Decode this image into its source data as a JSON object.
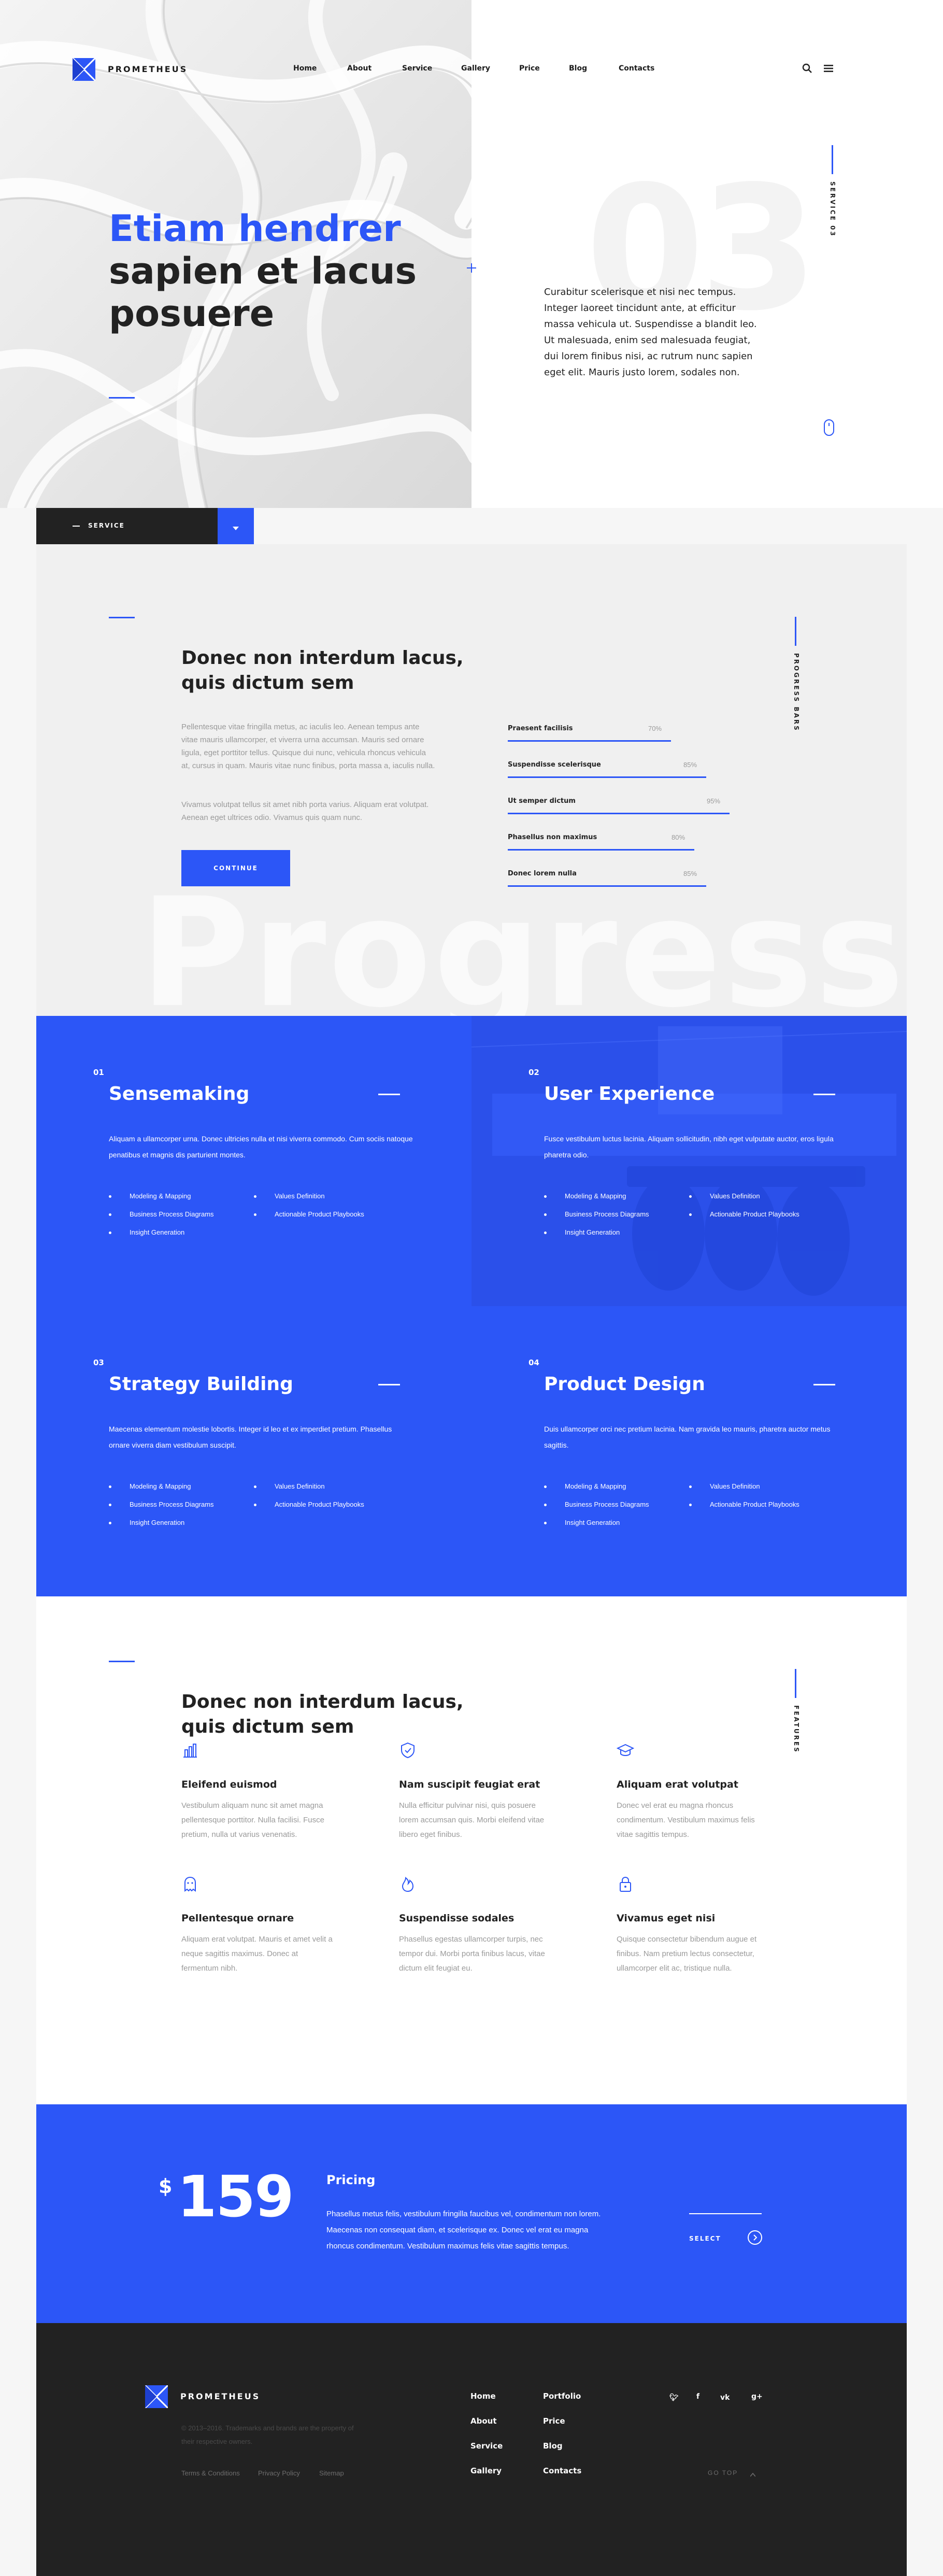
{
  "header": {
    "brand": "PROMETHEUS",
    "nav": [
      "Home",
      "About",
      "Service",
      "Gallery",
      "Price",
      "Blog",
      "Contacts"
    ],
    "icons": [
      "search-icon",
      "menu-icon"
    ]
  },
  "hero": {
    "title_line1": "Etiam hendrer",
    "title_line2": "sapien et lacus",
    "title_line3": "posuere",
    "big_number": "03",
    "vertical_label": "SERVICE 03",
    "paragraph": "Curabitur scelerisque et nisi nec tempus. Integer laoreet tincidunt ante, at efficitur massa vehicula ut. Suspendisse a blandit leo. Ut malesuada, enim sed malesuada feugiat, dui lorem finibus nisi, ac rutrum nunc sapien eget elit. Mauris justo lorem, sodales non."
  },
  "service_bar": {
    "label": "SERVICE"
  },
  "progress": {
    "title_line1": "Donec non interdum lacus,",
    "title_line2": "quis dictum sem",
    "paragraph1": "Pellentesque vitae fringilla metus, ac iaculis leo. Aenean tempus ante vitae mauris ullamcorper, et viverra urna accumsan. Mauris sed ornare ligula, eget porttitor tellus. Quisque dui nunc, vehicula rhoncus vehicula at, cursus in quam. Mauris vitae nunc finibus, porta massa a, iaculis nulla.",
    "paragraph2": "Vivamus volutpat tellus sit amet nibh porta varius. Aliquam erat volutpat. Aenean eget ultrices odio. Vivamus quis quam nunc.",
    "button": "CONTINUE",
    "vertical_label": "PROGRESS BARS",
    "watermark": "Progress",
    "bars": [
      {
        "label": "Praesent facilisis",
        "percent": "70%",
        "value": 0.7
      },
      {
        "label": "Suspendisse scelerisque",
        "percent": "85%",
        "value": 0.85
      },
      {
        "label": "Ut semper dictum",
        "percent": "95%",
        "value": 0.95
      },
      {
        "label": "Phasellus non maximus",
        "percent": "80%",
        "value": 0.8
      },
      {
        "label": "Donec lorem nulla",
        "percent": "85%",
        "value": 0.85
      }
    ]
  },
  "services": [
    {
      "num": "01",
      "title": "Sensemaking",
      "desc": "Aliquam a ullamcorper urna. Donec ultricies nulla et nisi viverra commodo. Cum sociis natoque penatibus et magnis dis parturient montes.",
      "items": [
        "Modeling & Mapping",
        "Business Process Diagrams",
        "Insight Generation",
        "Values Definition",
        "Actionable Product Playbooks"
      ]
    },
    {
      "num": "02",
      "title": "User Experience",
      "desc": "Fusce vestibulum luctus lacinia. Aliquam sollicitudin, nibh eget vulputate auctor, eros ligula pharetra odio.",
      "items": [
        "Modeling & Mapping",
        "Business Process Diagrams",
        "Insight Generation",
        "Values Definition",
        "Actionable Product Playbooks"
      ]
    },
    {
      "num": "03",
      "title": "Strategy Building",
      "desc": "Maecenas elementum molestie lobortis. Integer id leo et ex imperdiet pretium. Phasellus ornare viverra diam vestibulum suscipit.",
      "items": [
        "Modeling & Mapping",
        "Business Process Diagrams",
        "Insight Generation",
        "Values Definition",
        "Actionable Product Playbooks"
      ]
    },
    {
      "num": "04",
      "title": "Product Design",
      "desc": "Duis ullamcorper orci nec pretium lacinia. Nam gravida leo mauris, pharetra auctor metus sagittis.",
      "items": [
        "Modeling & Mapping",
        "Business Process Diagrams",
        "Insight Generation",
        "Values Definition",
        "Actionable Product Playbooks"
      ]
    }
  ],
  "features": {
    "title_line1": "Donec non interdum lacus,",
    "title_line2": "quis dictum sem",
    "vertical_label": "FEATURES",
    "items": [
      {
        "icon": "bar-chart-icon",
        "title": "Eleifend euismod",
        "desc": "Vestibulum aliquam nunc sit amet magna pellentesque porttitor. Nulla facilisi. Fusce pretium, nulla ut varius venenatis."
      },
      {
        "icon": "shield-icon",
        "title": "Nam suscipit feugiat erat",
        "desc": "Nulla efficitur pulvinar nisi, quis posuere lorem accumsan quis. Morbi eleifend vitae libero eget finibus."
      },
      {
        "icon": "graduation-cap-icon",
        "title": "Aliquam erat volutpat",
        "desc": "Donec vel erat eu magna rhoncus condimentum. Vestibulum maximus felis vitae sagittis tempus."
      },
      {
        "icon": "ghost-icon",
        "title": "Pellentesque ornare",
        "desc": "Aliquam erat volutpat. Mauris et amet velit a neque sagittis maximus. Donec at fermentum nibh."
      },
      {
        "icon": "fire-icon",
        "title": "Suspendisse sodales",
        "desc": "Phasellus egestas ullamcorper turpis, nec tempor dui. Morbi porta finibus lacus, vitae dictum elit feugiat eu."
      },
      {
        "icon": "lock-icon",
        "title": "Vivamus eget nisi",
        "desc": "Quisque consectetur bibendum augue et finibus. Nam pretium lectus consectetur, ullamcorper elit ac, tristique nulla."
      }
    ]
  },
  "pricing": {
    "currency": "$",
    "amount": "159",
    "title": "Pricing",
    "desc": "Phasellus metus felis, vestibulum fringilla faucibus vel, condimentum non lorem. Maecenas non consequat diam, et scelerisque ex. Donec vel erat eu magna rhoncus condimentum. Vestibulum maximus felis vitae sagittis tempus.",
    "select": "SELECT"
  },
  "footer": {
    "brand": "PROMETHEUS",
    "copyright": "© 2013–2016. Trademarks and brands are the property of their respective owners.",
    "links_bottom": [
      "Terms & Conditions",
      "Privacy Policy",
      "Sitemap"
    ],
    "col1": [
      "Home",
      "About",
      "Service",
      "Gallery"
    ],
    "col2": [
      "Portfolio",
      "Price",
      "Blog",
      "Contacts"
    ],
    "social": [
      "twitter-icon",
      "facebook-icon",
      "vk-icon",
      "google-plus-icon"
    ],
    "go_top": "GO TOP"
  },
  "colors": {
    "accent": "#2c56f7",
    "dark": "#222222",
    "light_bg": "#f0f0f0"
  }
}
